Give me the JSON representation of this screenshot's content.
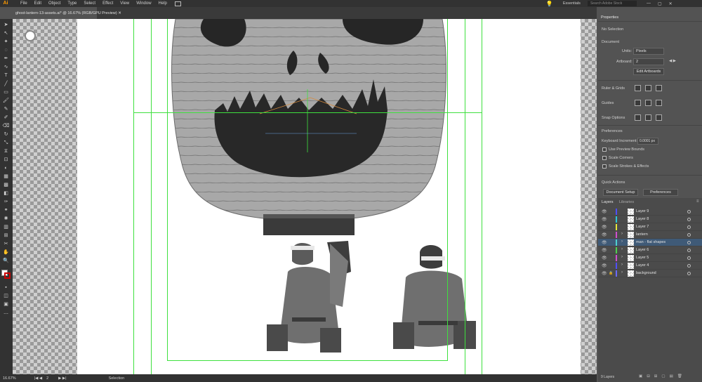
{
  "app_logo": "Ai",
  "menus": [
    "File",
    "Edit",
    "Object",
    "Type",
    "Select",
    "Effect",
    "View",
    "Window",
    "Help"
  ],
  "workspace": "Essentials",
  "search_placeholder": "Search Adobe Stock",
  "document_tab": "ghost-lantern-13-assets.ai* @ 16.67% (RGB/GPU Preview)",
  "status": {
    "zoom": "16.67%",
    "artboard": "2",
    "tool": "Selection"
  },
  "properties": {
    "tab": "Properties",
    "selection": "No Selection",
    "document": "Document",
    "units_label": "Units:",
    "units_value": "Pixels",
    "artboard_label": "Artboard:",
    "artboard_value": "2",
    "edit_artboards": "Edit Artboards",
    "ruler_grids": "Ruler & Grids",
    "guides": "Guides",
    "snap_options": "Snap Options",
    "preferences": "Preferences",
    "keyboard_increment_label": "Keyboard Increment:",
    "keyboard_increment_value": "0.0001 px",
    "use_preview_bounds": "Use Preview Bounds",
    "scale_corners": "Scale Corners",
    "scale_strokes": "Scale Strokes & Effects",
    "quick_actions": "Quick Actions",
    "document_setup": "Document Setup",
    "preferences_btn": "Preferences"
  },
  "layers_panel": {
    "tabs": [
      "Layers",
      "Libraries"
    ],
    "count": "9 Layers",
    "layers": [
      {
        "name": "Layer 9",
        "color": "#4f4fff"
      },
      {
        "name": "Layer 8",
        "color": "#2ec7d6"
      },
      {
        "name": "Layer 7",
        "color": "#e6e63a"
      },
      {
        "name": "lantern",
        "color": "#d04fd0"
      },
      {
        "name": "man - flat shapes",
        "color": "#4fd0d0"
      },
      {
        "name": "Layer 6",
        "color": "#4fd04f"
      },
      {
        "name": "Layer 5",
        "color": "#d04fd0"
      },
      {
        "name": "Layer 4",
        "color": "#4f4fff"
      },
      {
        "name": "background",
        "color": "#6a6aff"
      }
    ]
  }
}
